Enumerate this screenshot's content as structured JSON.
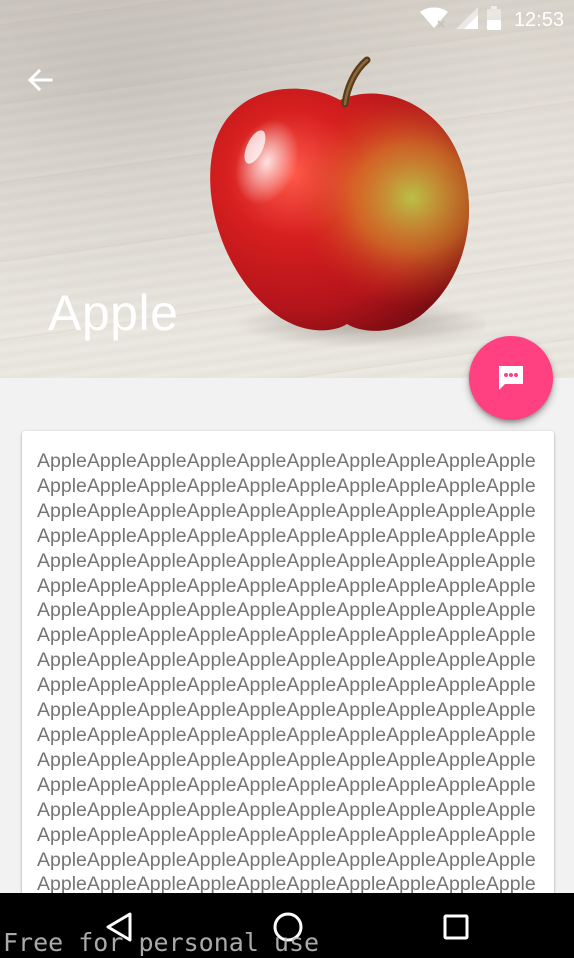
{
  "status_bar": {
    "time": "12:53",
    "icons": [
      "wifi-icon",
      "signal-icon",
      "battery-icon"
    ]
  },
  "toolbar": {
    "back_icon": "arrow-back-icon",
    "title": "Apple"
  },
  "fab": {
    "icon": "chat-bubble-icon",
    "color": "#ff4081"
  },
  "card": {
    "text": "AppleAppleAppleAppleAppleAppleAppleAppleAppleAppleAppleAppleAppleAppleAppleAppleAppleAppleAppleAppleAppleAppleAppleAppleAppleAppleAppleAppleAppleAppleAppleAppleAppleAppleAppleAppleAppleAppleAppleAppleAppleAppleAppleAppleAppleAppleAppleAppleAppleAppleAppleAppleAppleAppleAppleAppleAppleAppleAppleAppleAppleAppleAppleAppleAppleAppleAppleAppleAppleAppleAppleAppleAppleAppleAppleAppleAppleAppleAppleAppleAppleAppleAppleAppleAppleAppleAppleAppleAppleAppleAppleAppleAppleAppleAppleAppleAppleAppleAppleAppleAppleAppleAppleAppleAppleAppleAppleAppleAppleAppleAppleAppleAppleAppleAppleAppleAppleAppleAppleAppleAppleAppleAppleAppleAppleAppleAppleAppleAppleAppleAppleAppleAppleAppleAppleAppleAppleAppleAppleAppleAppleAppleAppleAppleAppleAppleAppleAppleAppleAppleAppleAppleAppleAppleAppleAppleAppleAppleAppleAppleAppleAppleAppleAppleAppleAppleAppleAppleAppleAppleAppleAppleAppleAppleAppleAppleAppleAppleAppleApple"
  },
  "nav_bar": {
    "buttons": [
      "back-triangle-icon",
      "home-circle-icon",
      "recent-apps-square-icon"
    ]
  },
  "watermark": "Free for personal use"
}
